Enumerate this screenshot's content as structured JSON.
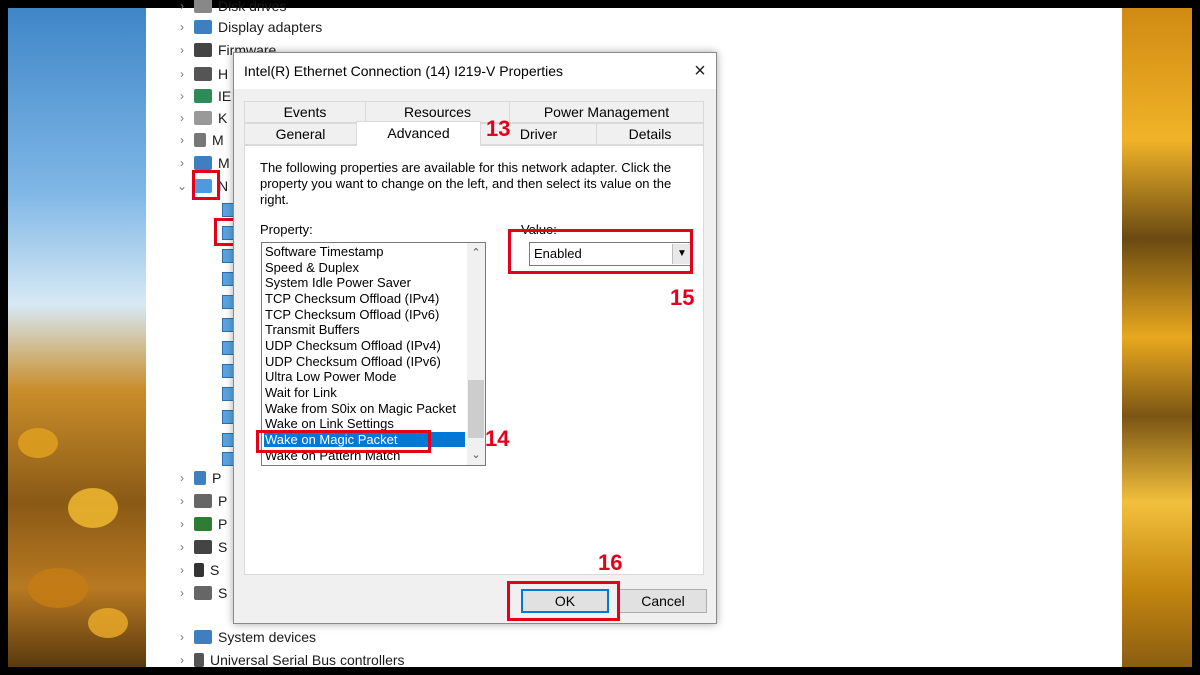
{
  "device_tree": {
    "items": [
      {
        "label": "Disk drives",
        "icon": "disk-icon"
      },
      {
        "label": "Display adapters",
        "icon": "display-adapter-icon"
      },
      {
        "label": "Firmware",
        "icon": "firmware-icon"
      },
      {
        "label": "H",
        "icon": "hid-icon"
      },
      {
        "label": "IE",
        "icon": "ide-icon"
      },
      {
        "label": "K",
        "icon": "keyboard-icon"
      },
      {
        "label": "M",
        "icon": "mouse-icon"
      },
      {
        "label": "M",
        "icon": "monitor-icon"
      },
      {
        "label": "N",
        "icon": "network-adapter-icon"
      },
      {
        "label": "P",
        "icon": "port-icon"
      },
      {
        "label": "P",
        "icon": "print-queue-icon"
      },
      {
        "label": "P",
        "icon": "processor-icon"
      },
      {
        "label": "S",
        "icon": "security-device-icon"
      },
      {
        "label": "S",
        "icon": "sensor-icon"
      },
      {
        "label": "S",
        "icon": "software-device-icon"
      },
      {
        "label": "System devices",
        "icon": "system-devices-icon"
      },
      {
        "label": "Universal Serial Bus controllers",
        "icon": "usb-icon"
      }
    ]
  },
  "dialog": {
    "title": "Intel(R) Ethernet Connection (14) I219-V Properties",
    "close_icon": "×",
    "tabs_row1": [
      "Events",
      "Resources",
      "Power Management"
    ],
    "tabs_row2": [
      "General",
      "Advanced",
      "Driver",
      "Details"
    ],
    "active_tab": "Advanced",
    "description": "The following properties are available for this network adapter. Click the property you want to change on the left, and then select its value on the right.",
    "property_label": "Property:",
    "value_label": "Value:",
    "properties": [
      "Software Timestamp",
      "Speed & Duplex",
      "System Idle Power Saver",
      "TCP Checksum Offload (IPv4)",
      "TCP Checksum Offload (IPv6)",
      "Transmit Buffers",
      "UDP Checksum Offload (IPv4)",
      "UDP Checksum Offload (IPv6)",
      "Ultra Low Power Mode",
      "Wait for Link",
      "Wake from S0ix on Magic Packet",
      "Wake on Link Settings",
      "Wake on Magic Packet",
      "Wake on Pattern Match"
    ],
    "selected_property": "Wake on Magic Packet",
    "value": "Enabled",
    "ok_label": "OK",
    "cancel_label": "Cancel"
  },
  "annotations": {
    "step_13": "13",
    "step_14": "14",
    "step_15": "15",
    "step_16": "16",
    "highlight_color": "#e3001b"
  },
  "colors": {
    "selection": "#0078d7",
    "dialog_bg": "#f0f0f0"
  }
}
